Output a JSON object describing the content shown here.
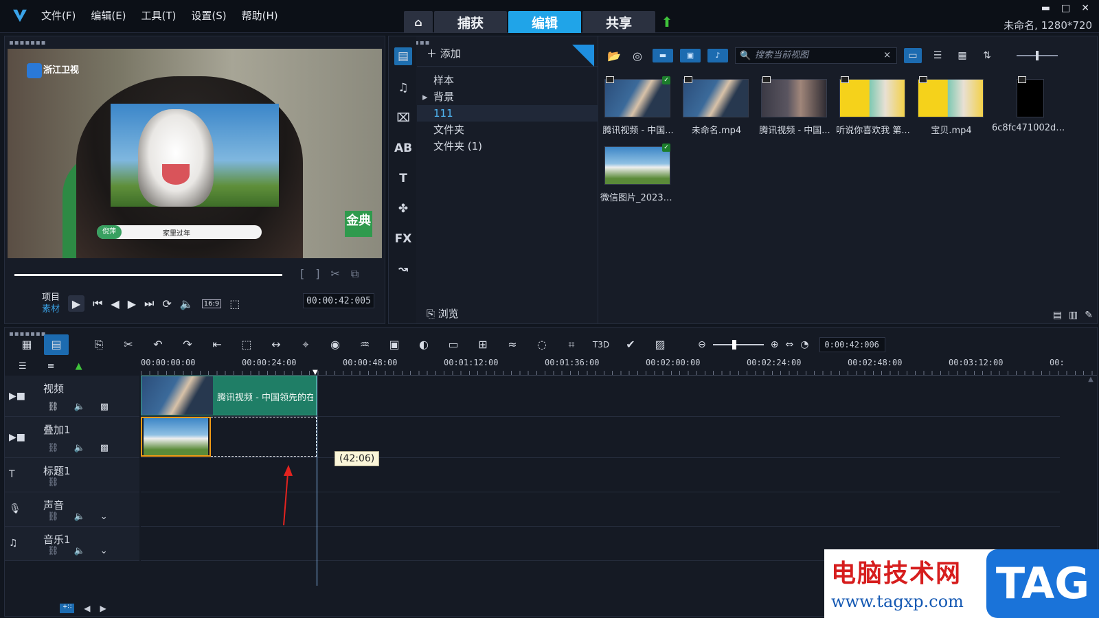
{
  "menu": [
    "文件(F)",
    "编辑(E)",
    "工具(T)",
    "设置(S)",
    "帮助(H)"
  ],
  "modes": {
    "capture": "捕获",
    "edit": "编辑",
    "share": "共享"
  },
  "project_info": "未命名, 1280*720",
  "window_controls": {
    "minimize": "▬",
    "maximize": "□",
    "close": "✕"
  },
  "preview": {
    "channel_logo": "浙江卫视",
    "caption_name": "倪萍",
    "caption_text": "家里过年",
    "brand": "金典",
    "project_label": "项目",
    "clip_label": "素材",
    "aspect": "16:9",
    "timecode": "00:00:42:005"
  },
  "library": {
    "add_label": "添加",
    "folders": [
      "样本",
      "背景",
      "111",
      "文件夹",
      "文件夹 (1)"
    ],
    "selected_folder": "111",
    "browse_label": "浏览",
    "search_placeholder": "搜索当前视图",
    "search_clear": "×",
    "media": [
      {
        "name": "腾讯视频 - 中国...",
        "kind": "video",
        "checked": true
      },
      {
        "name": "未命名.mp4",
        "kind": "video",
        "checked": false
      },
      {
        "name": "腾讯视频 - 中国...",
        "kind": "video",
        "checked": false
      },
      {
        "name": "听说你喜欢我 第...",
        "kind": "video",
        "checked": false
      },
      {
        "name": "宝贝.mp4",
        "kind": "video",
        "checked": false
      },
      {
        "name": "6c8fc471002dd...",
        "kind": "video",
        "checked": false
      },
      {
        "name": "微信图片_20230...",
        "kind": "image",
        "checked": true
      }
    ]
  },
  "timeline": {
    "timecode": "0:00:42:006",
    "ruler": [
      "00:00:00:00",
      "00:00:24:00",
      "00:00:48:00",
      "00:01:12:00",
      "00:01:36:00",
      "00:02:00:00",
      "00:02:24:00",
      "00:02:48:00",
      "00:03:12:00",
      "00:"
    ],
    "tracks": [
      {
        "name": "视频"
      },
      {
        "name": "叠加1"
      },
      {
        "name": "标题1"
      },
      {
        "name": "声音"
      },
      {
        "name": "音乐1"
      }
    ],
    "video_clip_label": "腾讯视频 - 中国领先的在",
    "tooltip": "(42:06)"
  },
  "watermark": {
    "title": "电脑技术网",
    "url": "www.tagxp.com",
    "tag": "TAG"
  }
}
